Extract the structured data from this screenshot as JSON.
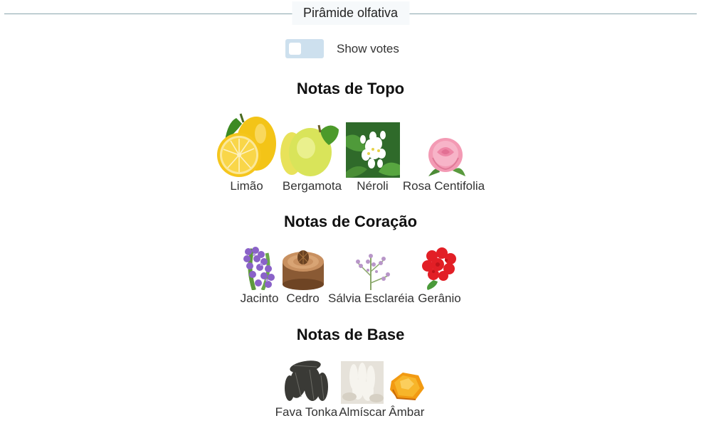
{
  "header": {
    "title": "Pirâmide olfativa"
  },
  "votes_toggle": {
    "label": "Show votes",
    "enabled": false
  },
  "sections": [
    {
      "title": "Notas de Topo",
      "notes": [
        {
          "name": "Limão",
          "icon": "lemon-icon"
        },
        {
          "name": "Bergamota",
          "icon": "bergamot-icon"
        },
        {
          "name": "Néroli",
          "icon": "neroli-flower-icon"
        },
        {
          "name": "Rosa Centifolia",
          "icon": "rose-icon"
        }
      ]
    },
    {
      "title": "Notas de Coração",
      "notes": [
        {
          "name": "Jacinto",
          "icon": "hyacinth-icon"
        },
        {
          "name": "Cedro",
          "icon": "cedar-log-icon"
        },
        {
          "name": "Sálvia Esclaréia",
          "icon": "clary-sage-icon"
        },
        {
          "name": "Gerânio",
          "icon": "geranium-icon"
        }
      ]
    },
    {
      "title": "Notas de Base",
      "notes": [
        {
          "name": "Fava Tonka",
          "icon": "tonka-bean-icon"
        },
        {
          "name": "Almíscar",
          "icon": "musk-icon"
        },
        {
          "name": "Âmbar",
          "icon": "amber-icon"
        }
      ]
    }
  ]
}
